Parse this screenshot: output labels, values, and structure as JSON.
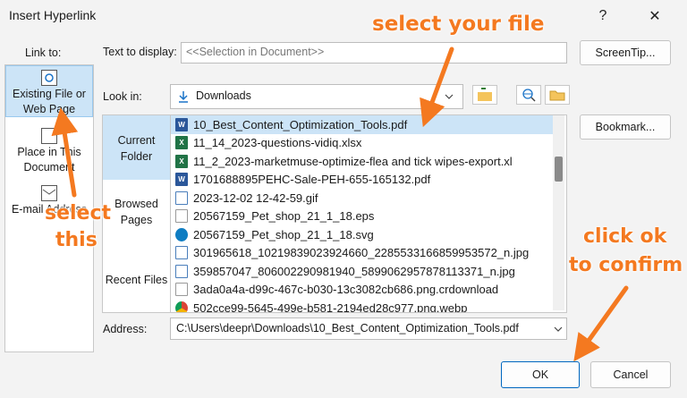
{
  "dialog": {
    "title": "Insert Hyperlink",
    "help": "?",
    "close": "✕"
  },
  "link_to": {
    "label": "Link to:",
    "items": [
      {
        "label": "Existing File or Web Page",
        "icon": "web-page-icon",
        "active": true
      },
      {
        "label": "Place in This Document",
        "icon": "document-place-icon"
      },
      {
        "label": "E-mail Address",
        "icon": "email-icon"
      }
    ]
  },
  "text_to_display": {
    "label": "Text to display:",
    "value": "<<Selection in Document>>"
  },
  "screentip_button": "ScreenTip...",
  "look_in": {
    "label": "Look in:",
    "value": "Downloads",
    "icon": "download-folder-icon"
  },
  "places": [
    {
      "label": "Current Folder",
      "active": true
    },
    {
      "label": "Browsed Pages"
    },
    {
      "label": "Recent Files"
    }
  ],
  "files": [
    {
      "name": "10_Best_Content_Optimization_Tools.pdf",
      "type": "word",
      "selected": true
    },
    {
      "name": "11_14_2023-questions-vidiq.xlsx",
      "type": "excel"
    },
    {
      "name": "11_2_2023-marketmuse-optimize-flea and tick wipes-export.xl",
      "type": "excel"
    },
    {
      "name": "1701688895PEHC-Sale-PEH-655-165132.pdf",
      "type": "word"
    },
    {
      "name": "2023-12-02 12-42-59.gif",
      "type": "img"
    },
    {
      "name": "20567159_Pet_shop_21_1_18.eps",
      "type": "file"
    },
    {
      "name": "20567159_Pet_shop_21_1_18.svg",
      "type": "edge"
    },
    {
      "name": "301965618_10219839023924660_2285533166859953572_n.jpg",
      "type": "img"
    },
    {
      "name": "359857047_806002290981940_5899062957878113371_n.jpg",
      "type": "img"
    },
    {
      "name": "3ada0a4a-d99c-467c-b030-13c3082cb686.png.crdownload",
      "type": "file"
    },
    {
      "name": "502cce99-5645-499e-b581-2194ed28c977.png.webp",
      "type": "chrome"
    }
  ],
  "bookmark_button": "Bookmark...",
  "address": {
    "label": "Address:",
    "value": "C:\\Users\\deepr\\Downloads\\10_Best_Content_Optimization_Tools.pdf"
  },
  "ok_button": "OK",
  "cancel_button": "Cancel",
  "annotations": {
    "select_file": "select your file",
    "select_line1": "select",
    "select_line2": "this",
    "click_ok_line1": "click ok",
    "click_ok_line2": "to confirm",
    "color": "#f47920"
  }
}
